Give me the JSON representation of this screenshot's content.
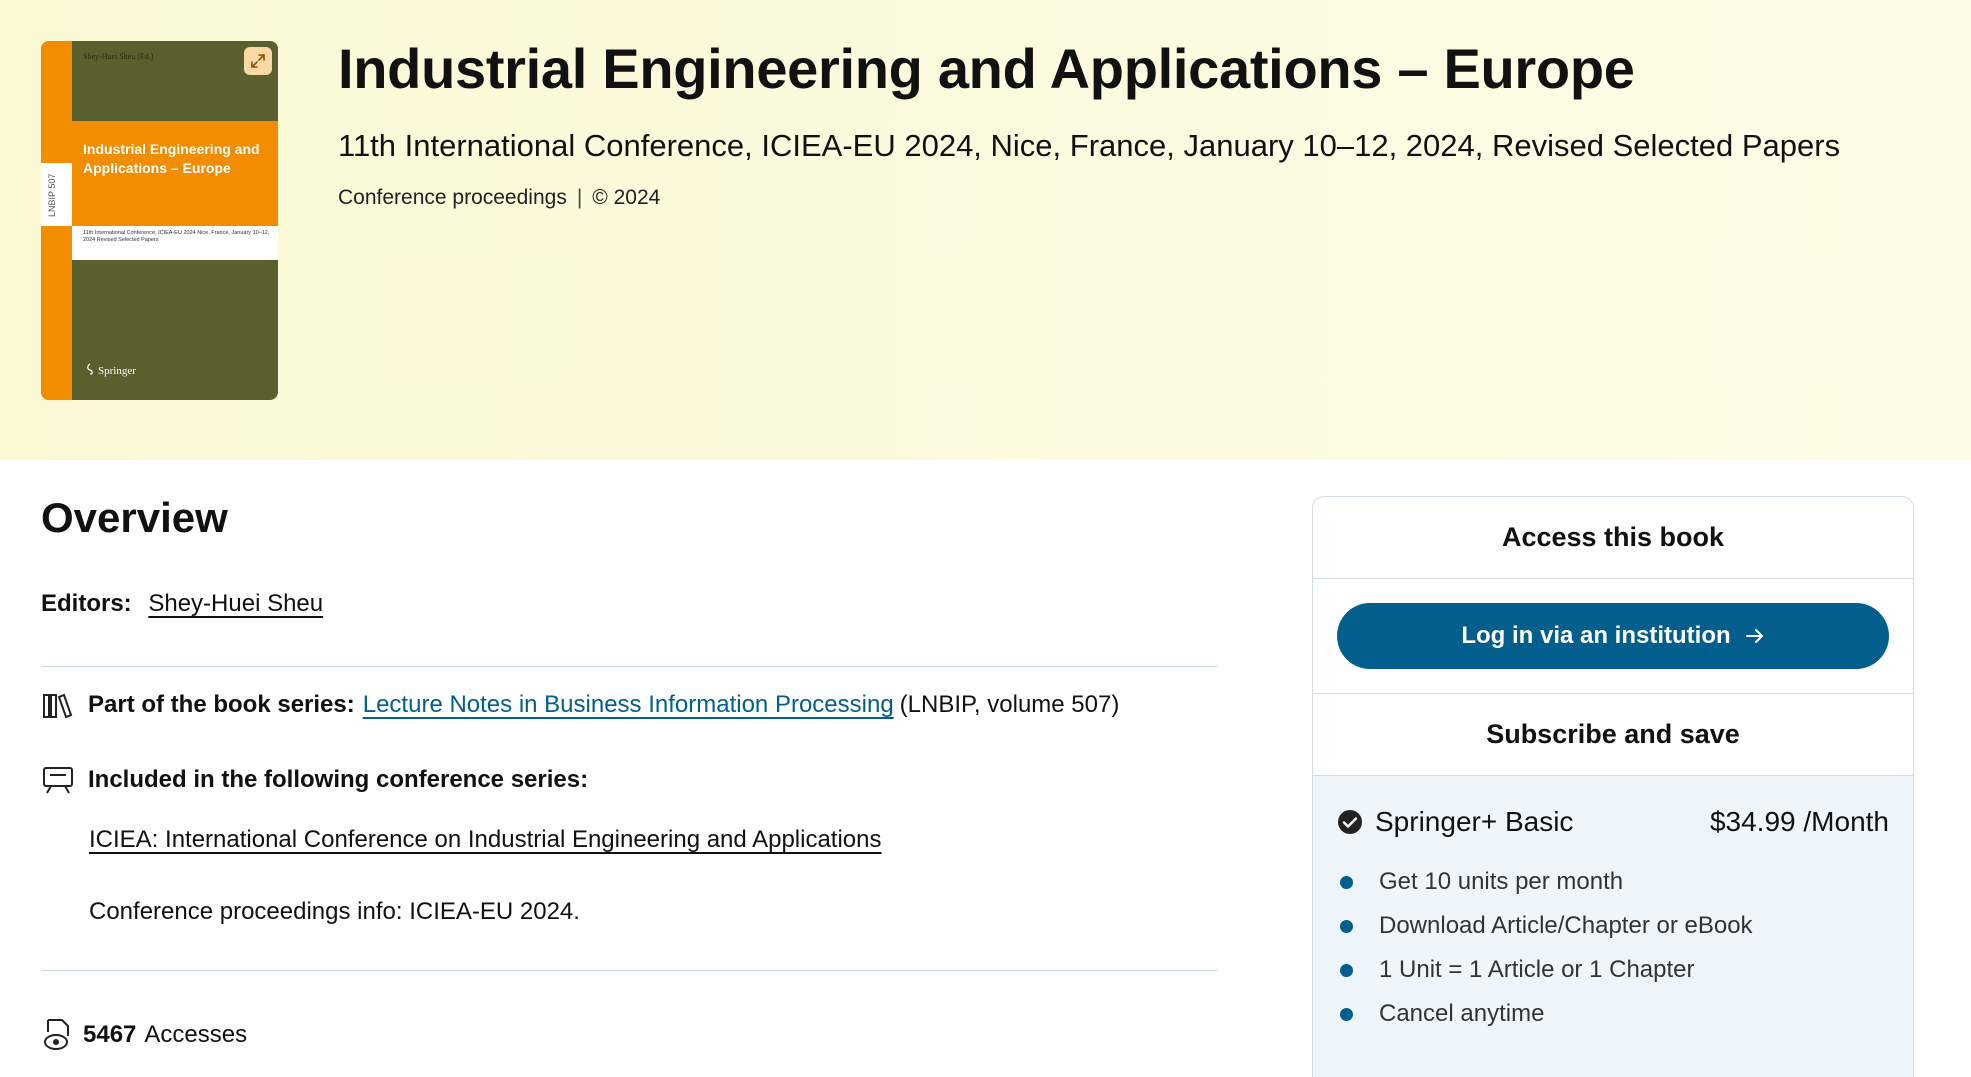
{
  "cover": {
    "editor": "Shey-Huei Sheu (Ed.)",
    "spine_label": "LNBIP 507",
    "title": "Industrial Engineering and Applications – Europe",
    "subtitle": "11th International Conference, ICIEA-EU 2024 Nice, France, January 10–12, 2024 Revised Selected Papers",
    "publisher": "Springer",
    "colors": {
      "orange": "#f28c00",
      "olive": "#5b5f2e"
    }
  },
  "header": {
    "title": "Industrial Engineering and Applications – Europe",
    "subtitle": "11th International Conference, ICIEA-EU 2024, Nice, France, January 10–12, 2024, Revised Selected Papers",
    "type": "Conference proceedings",
    "separator": "|",
    "year": "© 2024"
  },
  "overview": {
    "heading": "Overview",
    "editors_label": "Editors:",
    "editor_name": "Shey-Huei Sheu",
    "series_label": "Part of the book series:",
    "series_link": "Lecture Notes in Business Information Processing",
    "series_suffix": "(LNBIP, volume 507)",
    "conf_label": "Included in the following conference series:",
    "conf_link": "ICIEA: International Conference on Industrial Engineering and Applications",
    "conf_info": "Conference proceedings info: ICIEA-EU 2024.",
    "accesses_count": "5467",
    "accesses_label": "Accesses"
  },
  "access": {
    "heading": "Access this book",
    "login_label": "Log in via an institution",
    "subscribe_heading": "Subscribe and save",
    "plan_name": "Springer+ Basic",
    "plan_price": "$34.99 /Month",
    "features": [
      "Get 10 units per month",
      "Download Article/Chapter or eBook",
      "1 Unit = 1 Article or 1 Chapter",
      "Cancel anytime"
    ],
    "accent_color": "#025e8d"
  }
}
